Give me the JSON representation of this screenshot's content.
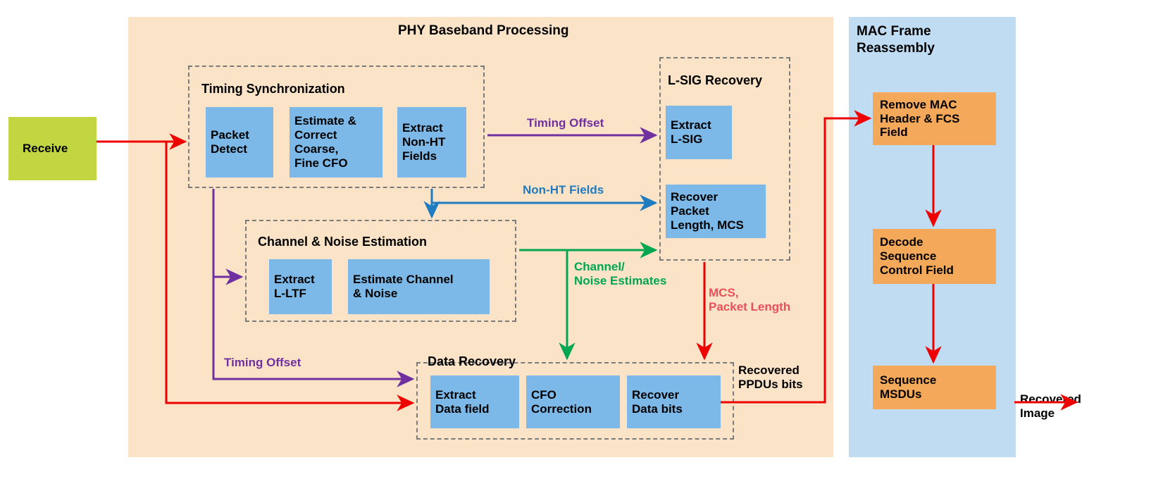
{
  "diagram": {
    "title_phy": "PHY Baseband Processing",
    "title_mac": "MAC Frame\nReassembly"
  },
  "colors": {
    "phy_panel": "#fbe3c7",
    "mac_panel": "#bfdcf2",
    "process_block": "#7cb9e8",
    "mac_block": "#f3a85a",
    "input_block": "#c2d642",
    "arrow_red": "#ee0000",
    "arrow_purple": "#7030a0",
    "arrow_blue": "#1f7cc0",
    "arrow_green": "#00a651",
    "label_mcs": "#e8505b"
  },
  "input": {
    "receive_label": "Receive"
  },
  "output": {
    "recovered_image_label": "Recovered\nImage"
  },
  "groups": {
    "timing_sync": {
      "title": "Timing Synchronization",
      "blocks": [
        {
          "label": "Packet\nDetect"
        },
        {
          "label": "Estimate &\nCorrect\nCoarse,\nFine CFO"
        },
        {
          "label": "Extract\nNon-HT\nFields"
        }
      ]
    },
    "lsig_recovery": {
      "title": "L-SIG Recovery",
      "blocks": [
        {
          "label": "Extract\nL-SIG"
        },
        {
          "label": "Recover\nPacket\nLength, MCS"
        }
      ]
    },
    "channel_noise": {
      "title": "Channel & Noise Estimation",
      "blocks": [
        {
          "label": "Extract\nL-LTF"
        },
        {
          "label": "Estimate Channel\n& Noise"
        }
      ]
    },
    "data_recovery": {
      "title": "Data Recovery",
      "blocks": [
        {
          "label": "Extract\nData field"
        },
        {
          "label": "CFO\nCorrection"
        },
        {
          "label": "Recover\nData bits"
        }
      ]
    },
    "mac_reassembly": {
      "blocks": [
        {
          "label": "Remove MAC\nHeader & FCS\nField"
        },
        {
          "label": "Decode\nSequence\nControl Field"
        },
        {
          "label": "Sequence\nMSDUs"
        }
      ]
    }
  },
  "edge_labels": {
    "timing_offset_top": "Timing Offset",
    "non_ht_fields": "Non-HT Fields",
    "channel_noise_estimates": "Channel/\nNoise Estimates",
    "mcs_packet_length": "MCS,\nPacket Length",
    "timing_offset_bottom": "Timing Offset",
    "recovered_ppdus_bits": "Recovered\nPPDUs bits"
  }
}
